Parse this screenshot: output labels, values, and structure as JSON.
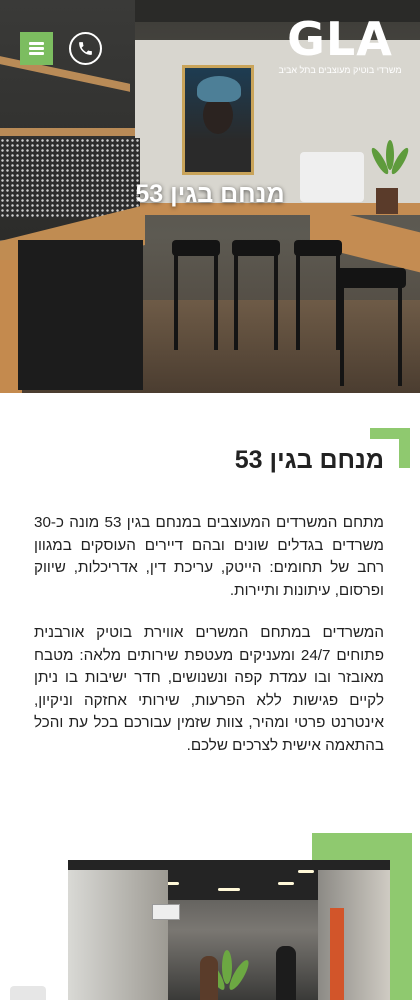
{
  "header": {
    "logo_text": "GLA",
    "logo_tagline": "משרדי בוטיק מעוצבים בתל אביב",
    "menu_icon": "hamburger-menu-icon",
    "phone_icon": "phone-icon"
  },
  "hero": {
    "title": "מנחם בגין 53"
  },
  "main": {
    "title": "מנחם בגין 53",
    "paragraphs": [
      "מתחם המשרדים המעוצבים במנחם בגין 53 מונה כ-30 משרדים בגדלים שונים ובהם דיירים העוסקים במגוון רחב של תחומים: הייטק, עריכת דין, אדריכלות, שיווק ופרסום, עיתונות ותיירות.",
      "המשרדים במתחם המשרים אווירת בוטיק אורבנית פתוחים 24/7 ומעניקים מעטפת שירותים מלאה: מטבח מאובזר ובו עמדת קפה ונשנושים, חדר ישיבות בו ניתן לקיים פגישות ללא הפרעות, שירותי אחזקה וניקיון, אינטרנט פרטי ומהיר, צוות שזמין עבורכם בכל עת והכל בהתאמה אישית לצרכים שלכם."
    ]
  },
  "colors": {
    "accent_green": "#8fc96f",
    "menu_green": "#7cbd60",
    "text": "#222222"
  }
}
